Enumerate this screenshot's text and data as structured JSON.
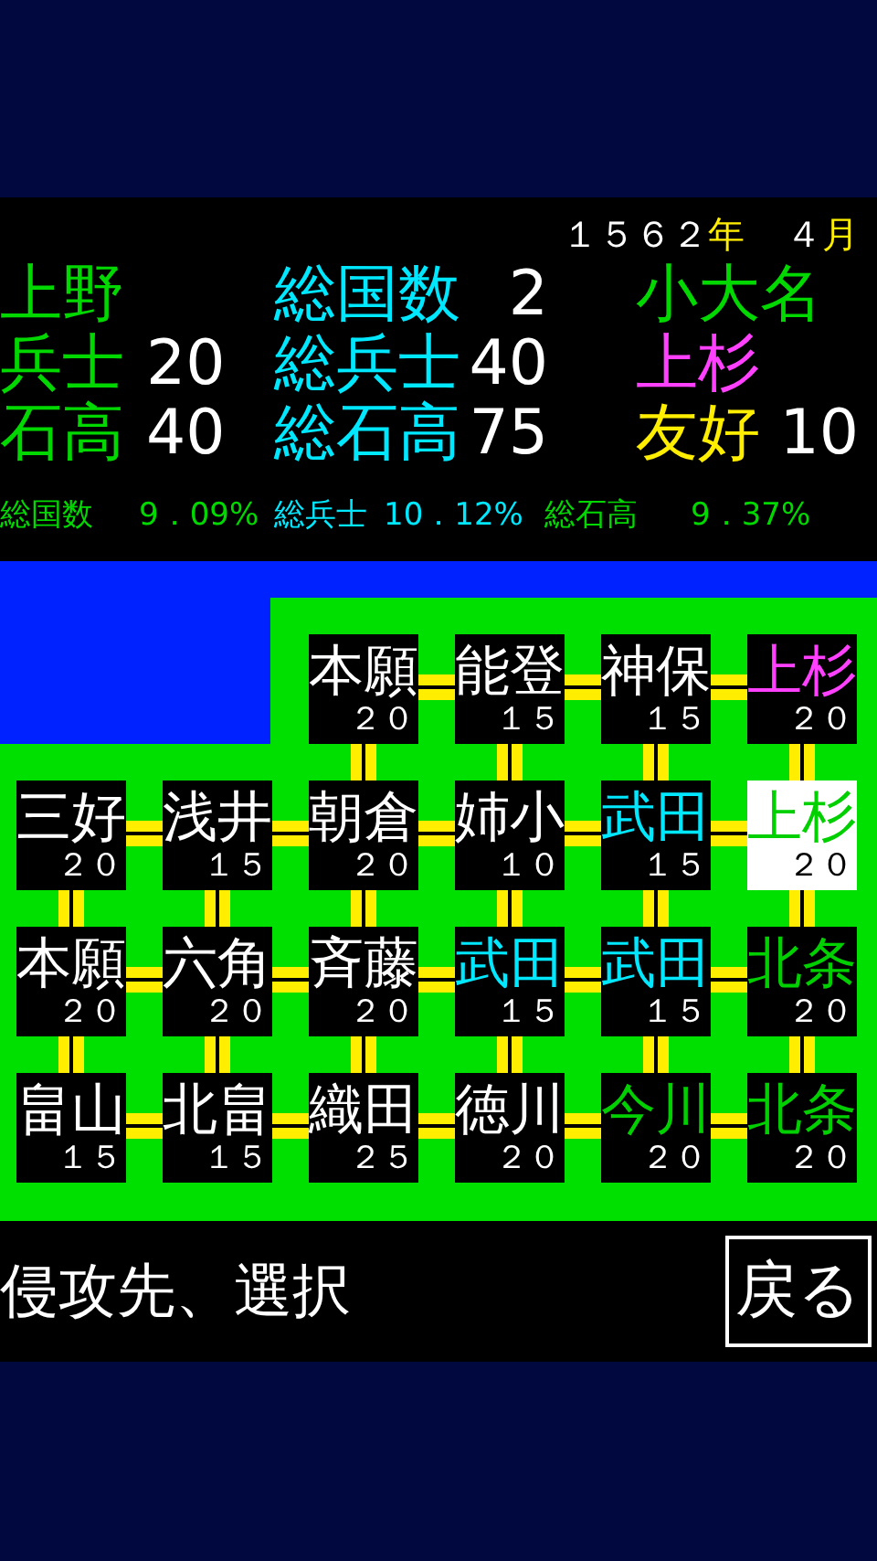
{
  "date": {
    "year": "１５６２",
    "year_unit": "年",
    "month": "４",
    "month_unit": "月"
  },
  "province": {
    "name": "上野",
    "soldiers_label": "兵士",
    "soldiers": "20",
    "kokudaka_label": "石高",
    "kokudaka": "40"
  },
  "totals": [
    {
      "label": "総国数",
      "value": "2"
    },
    {
      "label": "総兵士",
      "value": "40"
    },
    {
      "label": "総石高",
      "value": "75"
    }
  ],
  "neighbor": {
    "rank": "小大名",
    "clan": "上杉",
    "friendship_label": "友好",
    "friendship": "10"
  },
  "ratios": [
    {
      "label": "総国数",
      "value": "9．09%"
    },
    {
      "label": "総兵士",
      "value": "10．12%"
    },
    {
      "label": "総石高",
      "value": "9．37%"
    }
  ],
  "map": {
    "rows": [
      [
        "",
        "",
        {
          "name": "本願",
          "number": "２０",
          "color": "#ffffff",
          "selected": false
        },
        {
          "name": "能登",
          "number": "１５",
          "color": "#ffffff",
          "selected": false
        },
        {
          "name": "神保",
          "number": "１５",
          "color": "#ffffff",
          "selected": false
        },
        {
          "name": "上杉",
          "number": "２０",
          "color": "#ff40ff",
          "selected": false
        }
      ],
      [
        {
          "name": "三好",
          "number": "２０",
          "color": "#ffffff",
          "selected": false
        },
        {
          "name": "浅井",
          "number": "１５",
          "color": "#ffffff",
          "selected": false
        },
        {
          "name": "朝倉",
          "number": "２０",
          "color": "#ffffff",
          "selected": false
        },
        {
          "name": "姉小",
          "number": "１０",
          "color": "#ffffff",
          "selected": false
        },
        {
          "name": "武田",
          "number": "１５",
          "color": "#00e8ff",
          "selected": false
        },
        {
          "name": "上杉",
          "number": "２０",
          "color": "#00d000",
          "selected": true
        }
      ],
      [
        {
          "name": "本願",
          "number": "２０",
          "color": "#ffffff",
          "selected": false
        },
        {
          "name": "六角",
          "number": "２０",
          "color": "#ffffff",
          "selected": false
        },
        {
          "name": "斉藤",
          "number": "２０",
          "color": "#ffffff",
          "selected": false
        },
        {
          "name": "武田",
          "number": "１５",
          "color": "#00e8ff",
          "selected": false
        },
        {
          "name": "武田",
          "number": "１５",
          "color": "#00e8ff",
          "selected": false
        },
        {
          "name": "北条",
          "number": "２０",
          "color": "#00d000",
          "selected": false
        }
      ],
      [
        {
          "name": "畠山",
          "number": "１５",
          "color": "#ffffff",
          "selected": false
        },
        {
          "name": "北畠",
          "number": "１５",
          "color": "#ffffff",
          "selected": false
        },
        {
          "name": "織田",
          "number": "２５",
          "color": "#ffffff",
          "selected": false
        },
        {
          "name": "徳川",
          "number": "２０",
          "color": "#ffffff",
          "selected": false
        },
        {
          "name": "今川",
          "number": "２０",
          "color": "#00d000",
          "selected": false
        },
        {
          "name": "北条",
          "number": "２０",
          "color": "#00d000",
          "selected": false
        }
      ]
    ]
  },
  "prompt": "侵攻先、選択",
  "back_button": "戻る"
}
